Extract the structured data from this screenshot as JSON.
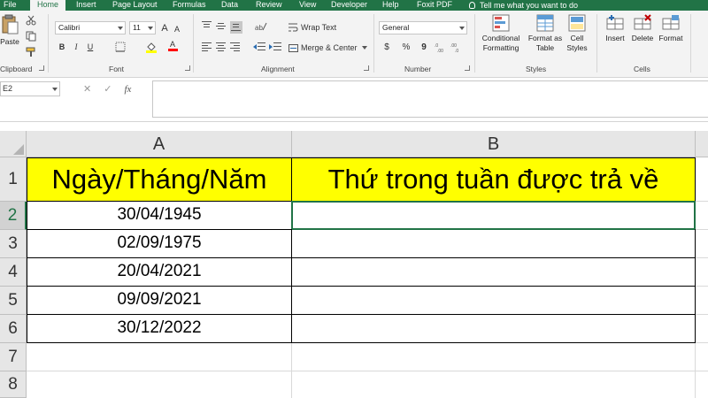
{
  "tabs": [
    {
      "label": "File",
      "active": false
    },
    {
      "label": "Home",
      "active": true
    },
    {
      "label": "Insert",
      "active": false
    },
    {
      "label": "Page Layout",
      "active": false
    },
    {
      "label": "Formulas",
      "active": false
    },
    {
      "label": "Data",
      "active": false
    },
    {
      "label": "Review",
      "active": false
    },
    {
      "label": "View",
      "active": false
    },
    {
      "label": "Developer",
      "active": false
    },
    {
      "label": "Help",
      "active": false
    },
    {
      "label": "Foxit PDF",
      "active": false
    }
  ],
  "tell_me": "Tell me what you want to do",
  "ribbon": {
    "clipboard": {
      "paste": "Paste",
      "group": "Clipboard"
    },
    "font": {
      "name": "Calibri",
      "size": "11",
      "bold": "B",
      "italic": "I",
      "underline": "U",
      "grow": "A",
      "shrink": "A",
      "font_color": "A",
      "group": "Font"
    },
    "alignment": {
      "wrap_text": "Wrap Text",
      "merge_center": "Merge & Center",
      "group": "Alignment"
    },
    "number": {
      "format": "General",
      "currency": "$",
      "percent": "%",
      "comma": "9",
      "group": "Number"
    },
    "styles": {
      "conditional": [
        "Conditional",
        "Formatting"
      ],
      "format_table": [
        "Format as",
        "Table"
      ],
      "cell_styles": [
        "Cell",
        "Styles"
      ],
      "group": "Styles"
    },
    "cells": {
      "insert": "Insert",
      "delete": "Delete",
      "format": "Format",
      "group": "Cells"
    }
  },
  "formula_bar": {
    "name_box": "E2",
    "cancel": "✕",
    "enter": "✓",
    "fx": "fx",
    "content": ""
  },
  "colors": {
    "accent": "#217346",
    "header_fill": "#ffff00"
  },
  "sheet": {
    "columns": [
      "A",
      "B"
    ],
    "rows": [
      "1",
      "2",
      "3",
      "4",
      "5",
      "6",
      "7",
      "8"
    ],
    "header_a": "Ngày/Tháng/Năm",
    "header_b": "Thứ trong tuần được trả về",
    "dates": [
      "30/04/1945",
      "02/09/1975",
      "20/04/2021",
      "09/09/2021",
      "30/12/2022"
    ]
  }
}
